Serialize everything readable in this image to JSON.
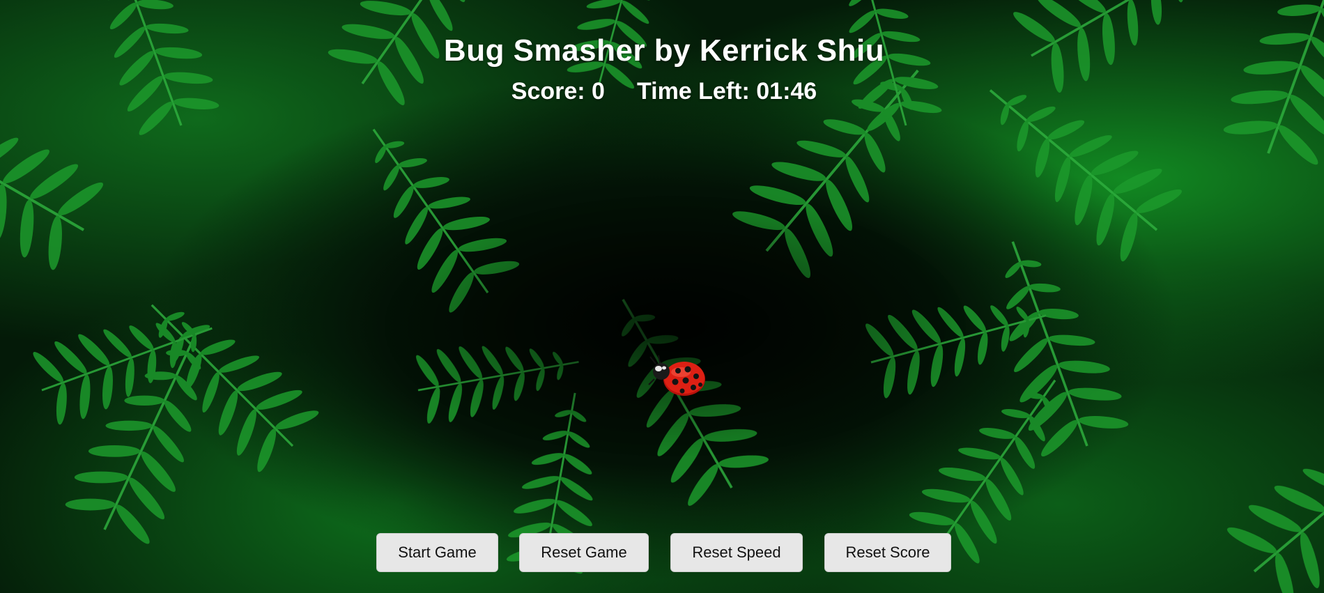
{
  "game": {
    "title": "Bug Smasher by Kerrick Shiu",
    "score_label": "Score: 0",
    "time_label": "Time Left: 01:46",
    "score": 0,
    "time_left": "01:46"
  },
  "bug": {
    "icon": "ladybug-icon",
    "color": "#d11a10"
  },
  "buttons": {
    "start": "Start Game",
    "reset_game": "Reset Game",
    "reset_speed": "Reset Speed",
    "reset_score": "Reset Score"
  },
  "background": {
    "icon": "fern-leaves-background",
    "accent": "#1f9a2e"
  }
}
